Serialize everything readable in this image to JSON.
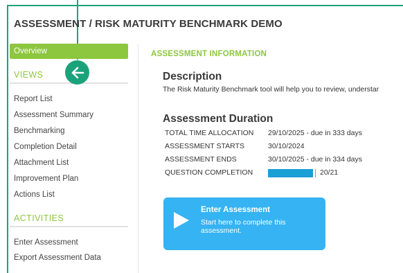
{
  "header": {
    "title": "ASSESSMENT / RISK MATURITY BENCHMARK DEMO"
  },
  "colors": {
    "accent_green": "#8dc63f",
    "teal": "#1aa37a",
    "button_blue": "#35b3f3",
    "progress_blue": "#1a9fd6"
  },
  "sidebar": {
    "active_item": "Overview",
    "views_heading": "VIEWS",
    "views": [
      "Report List",
      "Assessment Summary",
      "Benchmarking",
      "Completion Detail",
      "Attachment List",
      "Improvement Plan",
      "Actions List"
    ],
    "activities_heading": "ACTIVITIES",
    "activities": [
      "Enter Assessment",
      "Export Assessment Data"
    ],
    "back_icon": "arrow-left-icon"
  },
  "main": {
    "section_title": "ASSESSMENT INFORMATION",
    "description_heading": "Description",
    "description_text": "The Risk Maturity Benchmark tool will help you to review, understar",
    "duration_heading": "Assessment Duration",
    "rows": [
      {
        "label": "TOTAL TIME ALLOCATION",
        "value": "29/10/2025 - due in 333 days"
      },
      {
        "label": "ASSESSMENT STARTS",
        "value": "30/10/2024"
      },
      {
        "label": "ASSESSMENT ENDS",
        "value": "30/10/2025 - due in 334 days"
      }
    ],
    "completion_label": "QUESTION COMPLETION",
    "completion_text": "20/21",
    "completion_fraction": 0.952
  },
  "enter_card": {
    "title": "Enter Assessment",
    "subtitle": "Start here to complete this assessment.",
    "icon": "play-icon"
  }
}
